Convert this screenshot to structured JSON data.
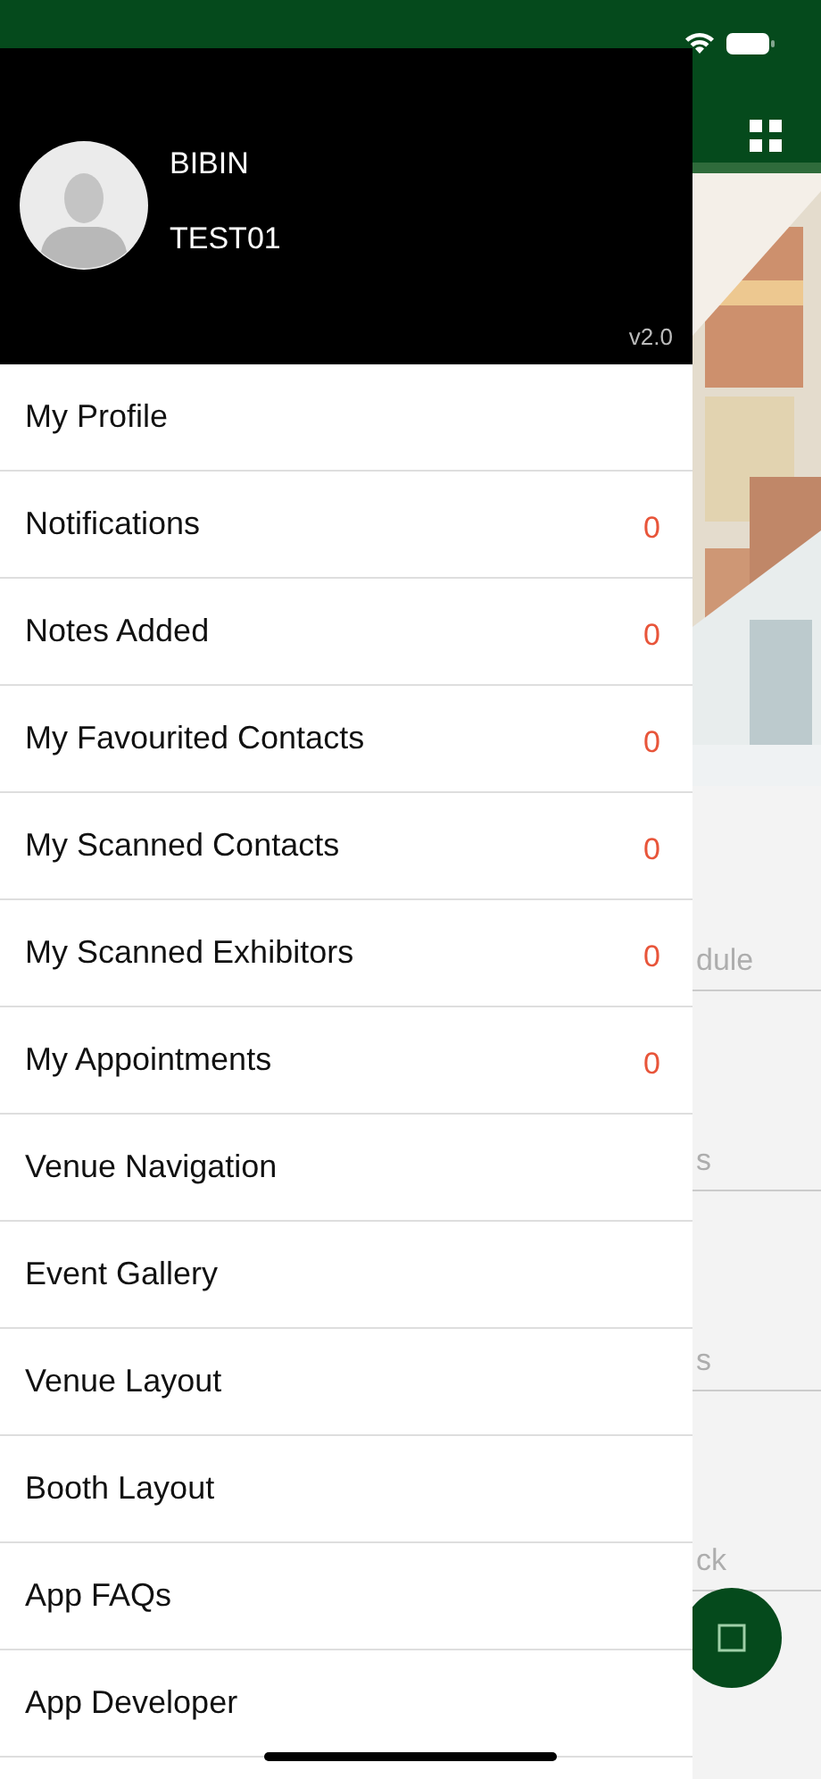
{
  "background": {
    "list_items": [
      "dule",
      "s",
      "s",
      "ck"
    ]
  },
  "drawer": {
    "user_name": "BIBIN",
    "user_id": "TEST01",
    "version": "v2.0",
    "items": [
      {
        "label": "My Profile"
      },
      {
        "label": "Notifications",
        "count": "0"
      },
      {
        "label": "Notes Added",
        "count": "0"
      },
      {
        "label": "My Favourited Contacts",
        "count": "0"
      },
      {
        "label": "My Scanned Contacts",
        "count": "0"
      },
      {
        "label": "My Scanned Exhibitors",
        "count": "0"
      },
      {
        "label": "My Appointments",
        "count": "0"
      },
      {
        "label": "Venue Navigation"
      },
      {
        "label": "Event Gallery"
      },
      {
        "label": "Venue Layout"
      },
      {
        "label": "Booth Layout"
      },
      {
        "label": "App FAQs"
      },
      {
        "label": "App Developer"
      }
    ]
  }
}
